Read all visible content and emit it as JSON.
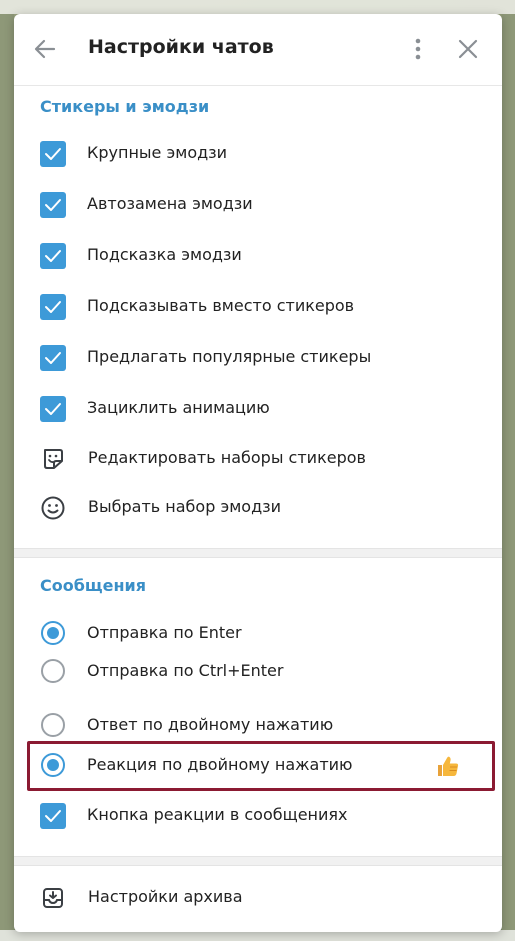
{
  "header": {
    "title": "Настройки чатов"
  },
  "stickers_section": {
    "title": "Стикеры и эмодзи",
    "items": [
      {
        "label": "Крупные эмодзи",
        "checked": true
      },
      {
        "label": "Автозамена эмодзи",
        "checked": true
      },
      {
        "label": "Подсказка эмодзи",
        "checked": true
      },
      {
        "label": "Подсказывать вместо стикеров",
        "checked": true
      },
      {
        "label": "Предлагать популярные стикеры",
        "checked": true
      },
      {
        "label": "Зациклить анимацию",
        "checked": true
      }
    ],
    "links": [
      {
        "label": "Редактировать наборы стикеров",
        "icon": "sticker-icon"
      },
      {
        "label": "Выбрать набор эмодзи",
        "icon": "smile-icon"
      }
    ]
  },
  "messages_section": {
    "title": "Сообщения",
    "send_options": [
      {
        "label": "Отправка по Enter",
        "selected": true
      },
      {
        "label": "Отправка по Ctrl+Enter",
        "selected": false
      }
    ],
    "double_click_options": [
      {
        "label": "Ответ по двойному нажатию",
        "selected": false
      },
      {
        "label": "Реакция по двойному нажатию",
        "selected": true
      }
    ],
    "reaction_emoji": "thumbs-up-icon",
    "reaction_button": {
      "label": "Кнопка реакции в сообщениях",
      "checked": true
    }
  },
  "archive": {
    "label": "Настройки архива",
    "icon": "archive-icon"
  },
  "colors": {
    "accent": "#3d9ad8",
    "section_title": "#3a8fc7",
    "highlight_border": "#8b1a32"
  }
}
